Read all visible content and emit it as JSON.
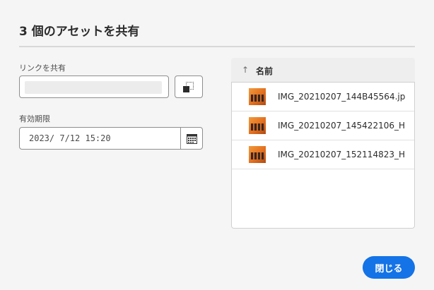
{
  "dialog": {
    "title": "3 個のアセットを共有",
    "link_label": "リンクを共有",
    "link_value": "",
    "expiry_label": "有効期限",
    "expiry_value": "2023/ 7/12 15:20",
    "close_label": "閉じる"
  },
  "table": {
    "column_header": "名前",
    "sort": "ascending",
    "rows": [
      {
        "name": "IMG_20210207_144B45564.jp"
      },
      {
        "name": "IMG_20210207_145422106_H"
      },
      {
        "name": "IMG_20210207_152114823_H"
      }
    ]
  },
  "icons": {
    "copy": "copy-icon",
    "calendar": "calendar-icon",
    "sort": "sort-ascending-icon"
  },
  "colors": {
    "accent": "#1473e6",
    "background": "#f5f5f5"
  }
}
